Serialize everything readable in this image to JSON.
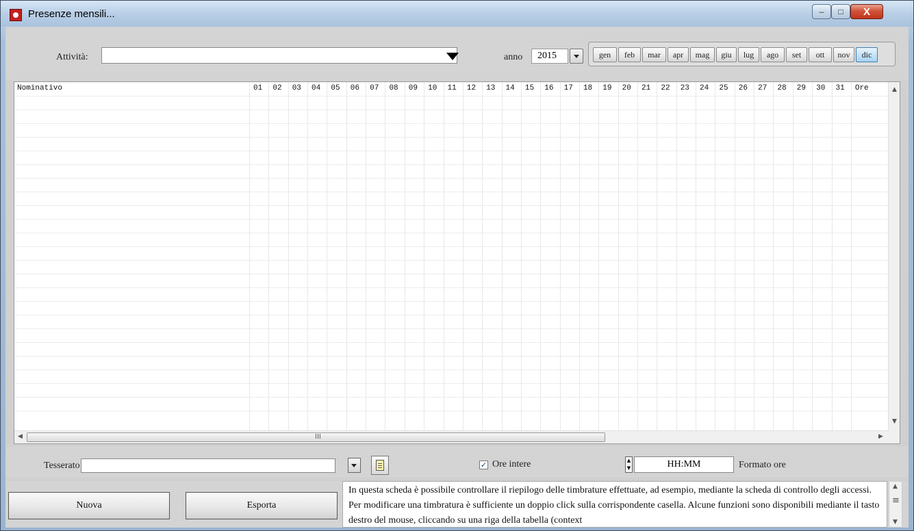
{
  "window": {
    "title": "Presenze mensili...",
    "minimize": "–",
    "maximize": "□",
    "close": "X"
  },
  "toolbar": {
    "attivita_label": "Attività:",
    "attivita_value": "",
    "anno_label": "anno",
    "anno_value": "2015",
    "months": [
      "gen",
      "feb",
      "mar",
      "apr",
      "mag",
      "giu",
      "lug",
      "ago",
      "set",
      "ott",
      "nov",
      "dic"
    ],
    "selected_month": "dic"
  },
  "grid": {
    "header_name": "Nominativo",
    "days": [
      "01",
      "02",
      "03",
      "04",
      "05",
      "06",
      "07",
      "08",
      "09",
      "10",
      "11",
      "12",
      "13",
      "14",
      "15",
      "16",
      "17",
      "18",
      "19",
      "20",
      "21",
      "22",
      "23",
      "24",
      "25",
      "26",
      "27",
      "28",
      "29",
      "30",
      "31"
    ],
    "header_total": "Ore",
    "rows": [],
    "hscroll_grip": "III"
  },
  "bottom": {
    "tesserato_label": "Tesserato",
    "tesserato_value": "",
    "ore_intere_label": "Ore intere",
    "ore_intere_checked": true,
    "format_value": "HH:MM",
    "format_label": "Formato ore"
  },
  "footer": {
    "nuova_label": "Nuova",
    "esporta_label": "Esporta",
    "info_text": "In questa scheda è possibile controllare il riepilogo delle timbrature effettuate, ad esempio, mediante la scheda di controllo degli accessi. Per modificare una timbratura è sufficiente un doppio click sulla corrispondente casella. Alcune funzioni sono disponibili mediante il tasto destro del mouse, cliccando su una riga della tabella (context"
  }
}
